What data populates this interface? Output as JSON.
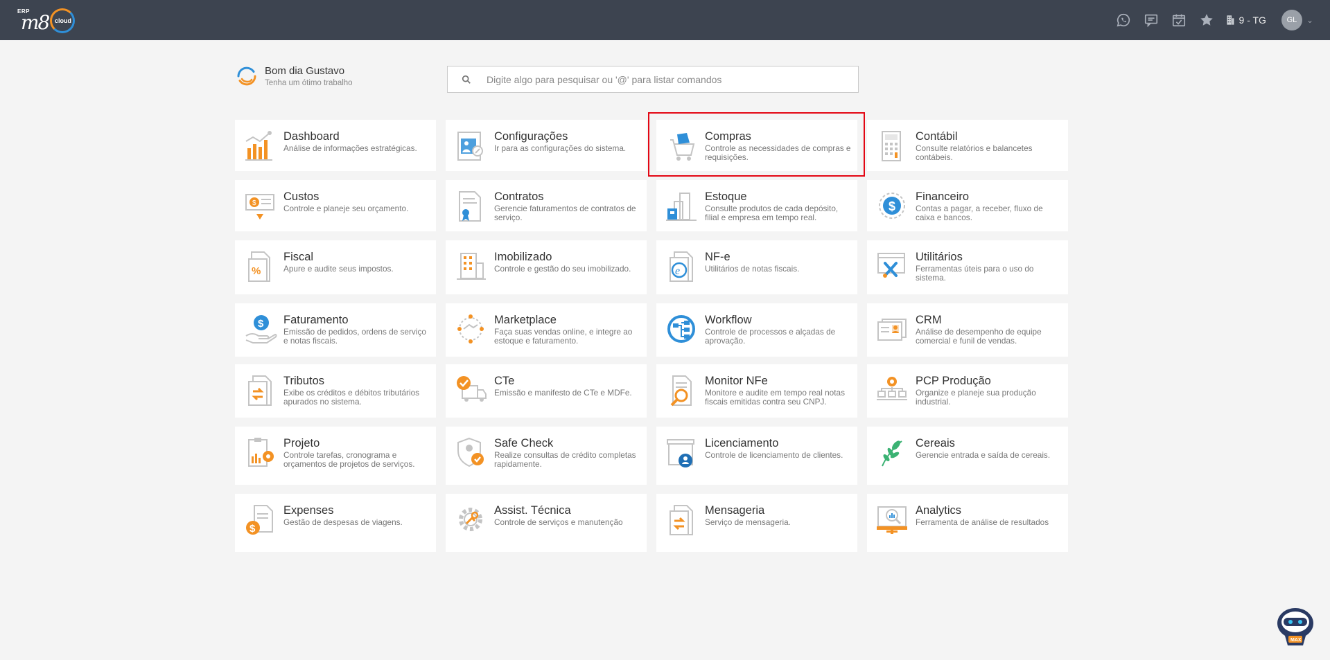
{
  "header": {
    "logo_erp": "ERP",
    "logo_m8": "m8",
    "logo_cloud": "cloud",
    "icons": [
      "whatsapp-icon",
      "chat-icon",
      "calendar-icon",
      "star-icon"
    ],
    "company": "9 - TG",
    "avatar_initials": "GL"
  },
  "greeting": {
    "title": "Bom dia Gustavo",
    "subtitle": "Tenha um ótimo trabalho"
  },
  "search": {
    "placeholder": "Digite algo para pesquisar ou '@' para listar comandos"
  },
  "modules": [
    {
      "title": "Dashboard",
      "desc": "Análise de informações estratégicas.",
      "icon": "dashboard-icon"
    },
    {
      "title": "Configurações",
      "desc": "Ir para as configurações do sistema.",
      "icon": "settings-icon"
    },
    {
      "title": "Compras",
      "desc": "Controle as necessidades de compras e requisições.",
      "icon": "cart-icon"
    },
    {
      "title": "Contábil",
      "desc": "Consulte relatórios e balancetes contábeis.",
      "icon": "calculator-icon"
    },
    {
      "title": "Custos",
      "desc": "Controle e planeje seu orçamento.",
      "icon": "costs-icon"
    },
    {
      "title": "Contratos",
      "desc": "Gerencie faturamentos de contratos de serviço.",
      "icon": "contract-icon"
    },
    {
      "title": "Estoque",
      "desc": "Consulte produtos de cada depósito, filial e empresa em tempo real.",
      "icon": "stock-icon"
    },
    {
      "title": "Financeiro",
      "desc": "Contas a pagar, a receber, fluxo de caixa e bancos.",
      "icon": "finance-icon"
    },
    {
      "title": "Fiscal",
      "desc": "Apure e audite seus impostos.",
      "icon": "fiscal-icon"
    },
    {
      "title": "Imobilizado",
      "desc": "Controle e gestão do seu imobilizado.",
      "icon": "building-icon"
    },
    {
      "title": "NF-e",
      "desc": "Utilitários de notas fiscais.",
      "icon": "nfe-icon"
    },
    {
      "title": "Utilitários",
      "desc": "Ferramentas úteis para o uso do sistema.",
      "icon": "tools-icon"
    },
    {
      "title": "Faturamento",
      "desc": "Emissão de pedidos, ordens de serviço e notas fiscais.",
      "icon": "billing-icon"
    },
    {
      "title": "Marketplace",
      "desc": "Faça suas vendas online, e integre ao estoque e faturamento.",
      "icon": "marketplace-icon"
    },
    {
      "title": "Workflow",
      "desc": "Controle de processos e alçadas de aprovação.",
      "icon": "workflow-icon"
    },
    {
      "title": "CRM",
      "desc": "Análise de desempenho de equipe comercial e funil de vendas.",
      "icon": "crm-icon"
    },
    {
      "title": "Tributos",
      "desc": "Exibe os créditos e débitos tributários apurados no sistema.",
      "icon": "taxes-icon"
    },
    {
      "title": "CTe",
      "desc": "Emissão e manifesto de CTe e MDFe.",
      "icon": "truck-icon"
    },
    {
      "title": "Monitor NFe",
      "desc": "Monitore e audite em tempo real notas fiscais emitidas contra seu CNPJ.",
      "icon": "monitor-icon"
    },
    {
      "title": "PCP Produção",
      "desc": "Organize e planeje sua produção industrial.",
      "icon": "production-icon"
    },
    {
      "title": "Projeto",
      "desc": "Controle tarefas, cronograma e orçamentos de projetos de serviços.",
      "icon": "project-icon"
    },
    {
      "title": "Safe Check",
      "desc": "Realize consultas de crédito completas rapidamente.",
      "icon": "shield-icon"
    },
    {
      "title": "Licenciamento",
      "desc": "Controle de licenciamento de clientes.",
      "icon": "license-icon"
    },
    {
      "title": "Cereais",
      "desc": "Gerencie entrada e saída de cereais.",
      "icon": "leaf-icon"
    },
    {
      "title": "Expenses",
      "desc": "Gestão de despesas de viagens.",
      "icon": "expenses-icon"
    },
    {
      "title": "Assist. Técnica",
      "desc": "Controle de serviços e manutenção",
      "icon": "gear-icon"
    },
    {
      "title": "Mensageria",
      "desc": "Serviço de mensageria.",
      "icon": "message-icon"
    },
    {
      "title": "Analytics",
      "desc": "Ferramenta de análise de resultados",
      "icon": "analytics-icon"
    }
  ],
  "highlighted_module": "Compras",
  "mascot": {
    "label": "MAX",
    "icon": "robot-mascot-icon"
  }
}
